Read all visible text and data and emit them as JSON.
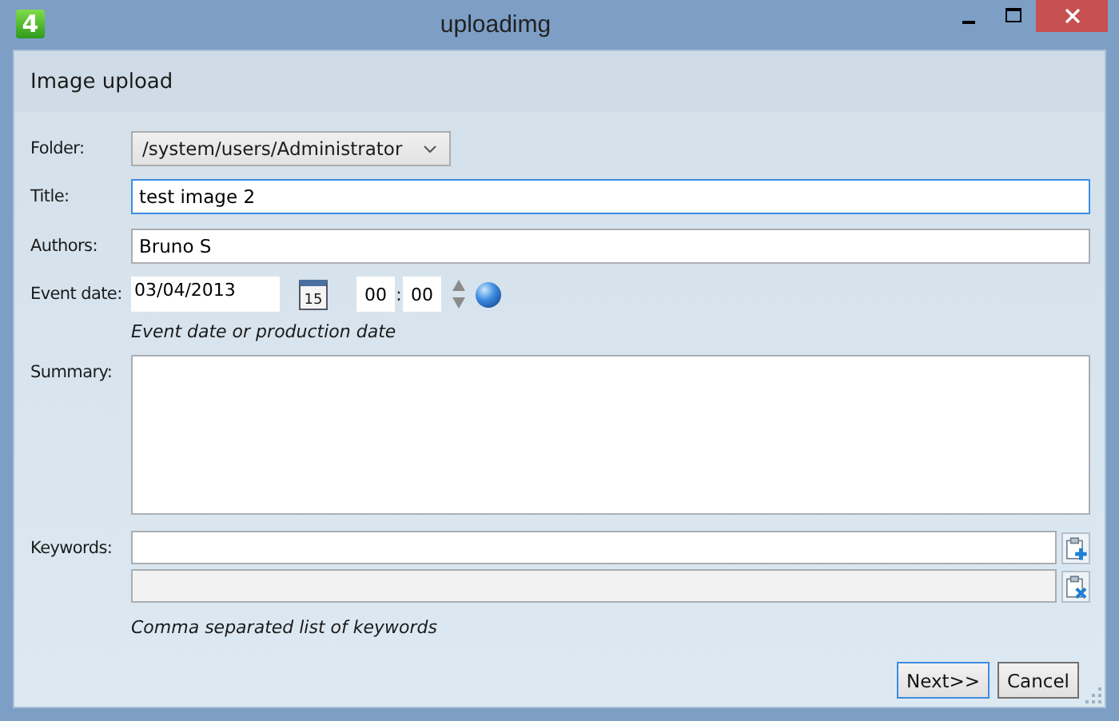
{
  "window": {
    "title": "uploadimg",
    "app_badge": "4"
  },
  "heading": "Image upload",
  "form": [
    {
      "kind": "select",
      "label": "Folder:",
      "value": "/system/users/Administrator"
    },
    {
      "kind": "text",
      "label": "Title:",
      "value": "test image 2",
      "focused": true
    },
    {
      "kind": "text",
      "label": "Authors:",
      "value": "Bruno S",
      "focused": false
    },
    {
      "kind": "datetime",
      "label": "Event date:",
      "date": "03/04/2013",
      "calendar_day": "15",
      "hour": "00",
      "separator": ":",
      "minute": "00",
      "hint": "Event date or production date"
    },
    {
      "kind": "textarea",
      "label": "Summary:"
    },
    {
      "kind": "keywords",
      "label": "Keywords:",
      "list_disabled": true,
      "hint": "Comma separated list of keywords"
    }
  ],
  "buttons": [
    {
      "label": "Next>>",
      "default": true
    },
    {
      "label": "Cancel",
      "default": false
    }
  ]
}
